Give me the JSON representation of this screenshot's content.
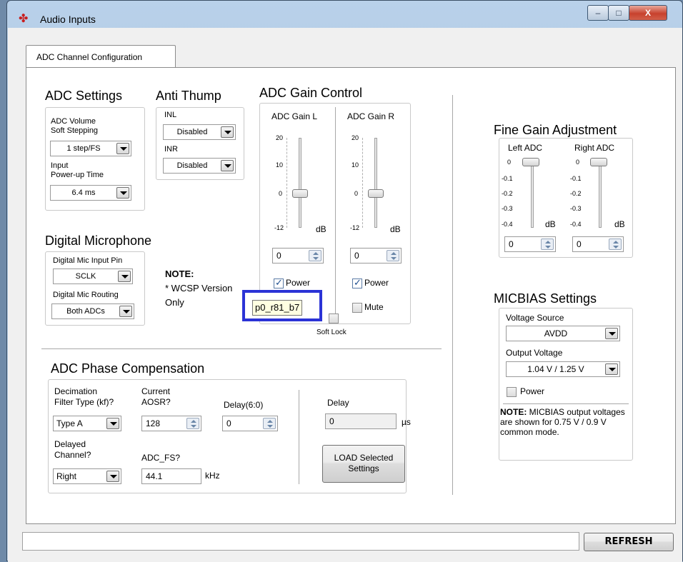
{
  "window": {
    "title": "Audio Inputs",
    "minimize": "–",
    "maximize": "□",
    "close": "X"
  },
  "tab": {
    "label": "ADC Channel Configuration"
  },
  "adc_settings": {
    "title": "ADC Settings",
    "volume_soft_stepping_label": "ADC Volume\nSoft Stepping",
    "volume_soft_stepping_value": "1 step/FS",
    "powerup_time_label": "Input\nPower-up Time",
    "powerup_time_value": "6.4 ms"
  },
  "anti_thump": {
    "title": "Anti Thump",
    "inl_label": "INL",
    "inl_value": "Disabled",
    "inr_label": "INR",
    "inr_value": "Disabled"
  },
  "adc_gain_control": {
    "title": "ADC Gain Control",
    "left": {
      "label": "ADC Gain L",
      "ticks": [
        "20",
        "10",
        "0",
        "-12"
      ],
      "unit": "dB",
      "value": "0",
      "power_label": "Power",
      "power_checked": true,
      "level": 0
    },
    "right": {
      "label": "ADC Gain R",
      "ticks": [
        "20",
        "10",
        "0",
        "-12"
      ],
      "unit": "dB",
      "value": "0",
      "power_label": "Power",
      "power_checked": true,
      "mute_label": "Mute",
      "mute_checked": false,
      "level": 0
    },
    "soft_lock_label": "Soft Lock"
  },
  "tooltip": {
    "text": "p0_r81_b7"
  },
  "digital_microphone": {
    "title": "Digital Microphone",
    "input_pin_label": "Digital Mic Input Pin",
    "input_pin_value": "SCLK",
    "routing_label": "Digital Mic Routing",
    "routing_value": "Both ADCs"
  },
  "note": {
    "title": "NOTE:",
    "line1": "* WCSP Version",
    "line2": "Only"
  },
  "fine_gain": {
    "title": "Fine Gain Adjustment",
    "left": {
      "label": "Left ADC",
      "ticks": [
        "0",
        "-0.1",
        "-0.2",
        "-0.3",
        "-0.4"
      ],
      "unit": "dB",
      "value": "0"
    },
    "right": {
      "label": "Right ADC",
      "ticks": [
        "0",
        "-0.1",
        "-0.2",
        "-0.3",
        "-0.4"
      ],
      "unit": "dB",
      "value": "0"
    }
  },
  "micbias": {
    "title": "MICBIAS Settings",
    "voltage_source_label": "Voltage Source",
    "voltage_source_value": "AVDD",
    "output_voltage_label": "Output Voltage",
    "output_voltage_value": "1.04 V / 1.25 V",
    "power_label": "Power",
    "note_bold": "NOTE:",
    "note_text": " MICBIAS output voltages are shown for 0.75 V / 0.9 V common mode."
  },
  "phase_comp": {
    "title": "ADC Phase Compensation",
    "decimation_label": "Decimation\nFilter Type (kf)?",
    "decimation_value": "Type A",
    "aosr_label": "Current\nAOSR?",
    "aosr_value": "128",
    "delay60_label": "Delay(6:0)",
    "delay60_value": "0",
    "delay_label": "Delay",
    "delay_value": "0",
    "delay_unit": "µs",
    "delayed_channel_label": "Delayed\nChannel?",
    "delayed_channel_value": "Right",
    "adc_fs_label": "ADC_FS?",
    "adc_fs_value": "44.1",
    "adc_fs_unit": "kHz",
    "load_button": "LOAD Selected\nSettings"
  },
  "footer": {
    "status_text": "",
    "refresh_button": "REFRESH"
  }
}
